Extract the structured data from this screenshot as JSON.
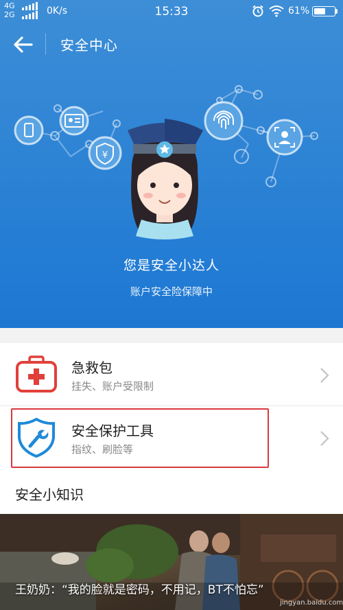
{
  "status_bar": {
    "network": [
      "4G",
      "2G"
    ],
    "speed": "0K/s",
    "time": "15:33",
    "battery_percent": "61%",
    "battery_level": 0.61,
    "icons": [
      "signal-bars-icon",
      "alarm-clock-icon",
      "wifi-icon",
      "battery-icon"
    ]
  },
  "header": {
    "back_icon": "arrow-left-icon",
    "title": "安全中心"
  },
  "hero": {
    "title": "您是安全小达人",
    "subtitle": "账户安全险保障中",
    "illustration_icons": [
      "phone-icon",
      "id-card-icon",
      "yuan-shield-icon",
      "fingerprint-icon",
      "face-scan-icon",
      "police-girl-avatar"
    ],
    "color_top": "#3d8ed6",
    "color_bottom": "#1d78d3"
  },
  "list": [
    {
      "title": "急救包",
      "subtitle": "挂失、账户受限制",
      "icon": "first-aid-kit-icon",
      "icon_color": "#e0403a"
    },
    {
      "title": "安全保护工具",
      "subtitle": "指纹、刷脸等",
      "icon": "wrench-shield-icon",
      "icon_color": "#1f8ad8",
      "highlighted": true
    }
  ],
  "section": {
    "title": "安全小知识"
  },
  "banner": {
    "caption": "王奶奶：“我的脸就是密码，不用记，BT不怕忘”",
    "watermark": "jingyan.baidu.com"
  },
  "colors": {
    "highlight_border": "#d9383d",
    "text_primary": "#222222",
    "text_secondary": "#888888"
  }
}
